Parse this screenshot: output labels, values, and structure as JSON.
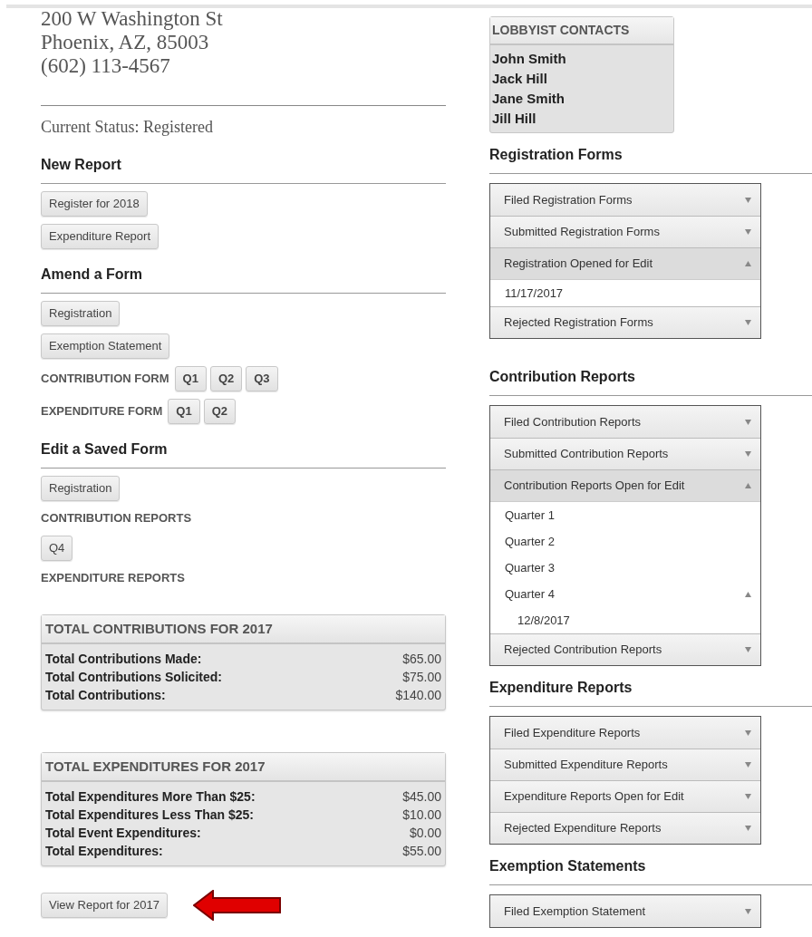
{
  "address_lines": [
    "200 W Washington St",
    "Phoenix, AZ, 85003",
    "(602) 113-4567"
  ],
  "status": "Current Status: Registered",
  "sections": [
    {
      "heading": "New Report",
      "items": [
        {
          "kind": "button",
          "label": "Register for 2018"
        },
        {
          "kind": "button",
          "label": "Expenditure Report"
        }
      ]
    },
    {
      "heading": "Amend a Form",
      "items": [
        {
          "kind": "button",
          "label": "Registration"
        },
        {
          "kind": "button",
          "label": "Exemption Statement"
        },
        {
          "kind": "group",
          "label": "CONTRIBUTION FORM",
          "buttons": [
            "Q1",
            "Q2",
            "Q3"
          ]
        },
        {
          "kind": "group",
          "label": "EXPENDITURE FORM",
          "buttons": [
            "Q1",
            "Q2"
          ]
        }
      ]
    },
    {
      "heading": "Edit a Saved Form",
      "items": [
        {
          "kind": "button",
          "label": "Registration"
        },
        {
          "kind": "label",
          "label": "CONTRIBUTION REPORTS"
        },
        {
          "kind": "button",
          "label": "Q4"
        },
        {
          "kind": "label",
          "label": "EXPENDITURE REPORTS"
        }
      ]
    }
  ],
  "totals": [
    {
      "title": "TOTAL CONTRIBUTIONS FOR 2017",
      "rows": [
        {
          "label": "Total Contributions Made:",
          "value": "$65.00"
        },
        {
          "label": "Total Contributions Solicited:",
          "value": "$75.00"
        },
        {
          "label": "Total Contributions:",
          "value": "$140.00"
        }
      ]
    },
    {
      "title": "TOTAL EXPENDITURES FOR 2017",
      "rows": [
        {
          "label": "Total Expenditures More Than $25:",
          "value": "$45.00"
        },
        {
          "label": "Total Expenditures Less Than $25:",
          "value": "$10.00"
        },
        {
          "label": "Total Event Expenditures:",
          "value": "$0.00"
        },
        {
          "label": "Total Expenditures:",
          "value": "$55.00"
        }
      ]
    }
  ],
  "view_button": "View Report for 2017",
  "lobbyist_contacts": {
    "title": "LOBBYIST CONTACTS",
    "names": [
      "John Smith",
      "Jack Hill",
      "Jane Smith",
      "Jill Hill"
    ]
  },
  "accordions": [
    {
      "heading": "Registration Forms",
      "panels": [
        {
          "title": "Filed Registration Forms",
          "expanded": false
        },
        {
          "title": "Submitted Registration Forms",
          "expanded": false
        },
        {
          "title": "Registration Opened for Edit",
          "expanded": true,
          "children": [
            {
              "label": "11/17/2017"
            }
          ]
        },
        {
          "title": "Rejected Registration Forms",
          "expanded": false
        }
      ]
    },
    {
      "heading": "Contribution Reports",
      "panels": [
        {
          "title": "Filed Contribution Reports",
          "expanded": false
        },
        {
          "title": "Submitted Contribution Reports",
          "expanded": false
        },
        {
          "title": "Contribution Reports Open for Edit",
          "expanded": true,
          "children": [
            {
              "label": "Quarter 1"
            },
            {
              "label": "Quarter 2"
            },
            {
              "label": "Quarter 3"
            },
            {
              "label": "Quarter 4",
              "expanded": true,
              "children": [
                {
                  "label": "12/8/2017"
                }
              ]
            }
          ]
        },
        {
          "title": "Rejected Contribution Reports",
          "expanded": false
        }
      ]
    },
    {
      "heading": "Expenditure Reports",
      "panels": [
        {
          "title": "Filed Expenditure Reports",
          "expanded": false
        },
        {
          "title": "Submitted Expenditure Reports",
          "expanded": false
        },
        {
          "title": "Expenditure Reports Open for Edit",
          "expanded": false
        },
        {
          "title": "Rejected Expenditure Reports",
          "expanded": false
        }
      ]
    },
    {
      "heading": "Exemption Statements",
      "panels": [
        {
          "title": "Filed Exemption Statement",
          "expanded": false
        }
      ]
    }
  ]
}
